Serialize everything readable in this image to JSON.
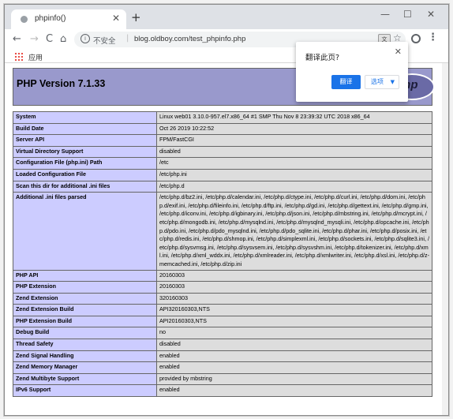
{
  "browser": {
    "tab_title": "phpinfo()",
    "tab_close": "✕",
    "new_tab": "+",
    "window_controls": {
      "minimize": "—",
      "maximize": "☐",
      "close": "✕"
    },
    "nav": {
      "back": "←",
      "forward": "→",
      "reload": "C",
      "home": "⌂"
    },
    "security_label": "不安全",
    "url": "blog.oldboy.com/test_phpinfo.php",
    "bookmarks": {
      "apps_label": "应用"
    },
    "icons": [
      "favicon",
      "back-icon",
      "forward-icon",
      "reload-icon",
      "home-icon",
      "info-icon",
      "translate-icon",
      "star-icon",
      "account-icon",
      "menu-icon",
      "apps-icon"
    ]
  },
  "translate_popup": {
    "title": "翻译此页?",
    "translate_button": "翻译",
    "options_button": "选项",
    "close": "✕"
  },
  "page": {
    "title": "PHP Version 7.1.33",
    "logo_text": "php",
    "rows": [
      {
        "key": "System",
        "value": "Linux web01 3.10.0-957.el7.x86_64 #1 SMP Thu Nov 8 23:39:32 UTC 2018 x86_64"
      },
      {
        "key": "Build Date",
        "value": "Oct 26 2019 10:22:52"
      },
      {
        "key": "Server API",
        "value": "FPM/FastCGI"
      },
      {
        "key": "Virtual Directory Support",
        "value": "disabled"
      },
      {
        "key": "Configuration File (php.ini) Path",
        "value": "/etc"
      },
      {
        "key": "Loaded Configuration File",
        "value": "/etc/php.ini"
      },
      {
        "key": "Scan this dir for additional .ini files",
        "value": "/etc/php.d"
      },
      {
        "key": "Additional .ini files parsed",
        "value": "/etc/php.d/bz2.ini, /etc/php.d/calendar.ini, /etc/php.d/ctype.ini, /etc/php.d/curl.ini, /etc/php.d/dom.ini, /etc/php.d/exif.ini, /etc/php.d/fileinfo.ini, /etc/php.d/ftp.ini, /etc/php.d/gd.ini, /etc/php.d/gettext.ini, /etc/php.d/gmp.ini, /etc/php.d/iconv.ini, /etc/php.d/igbinary.ini, /etc/php.d/json.ini, /etc/php.d/mbstring.ini, /etc/php.d/mcrypt.ini, /etc/php.d/mongodb.ini, /etc/php.d/mysqlnd.ini, /etc/php.d/mysqlnd_mysqli.ini, /etc/php.d/opcache.ini, /etc/php.d/pdo.ini, /etc/php.d/pdo_mysqlnd.ini, /etc/php.d/pdo_sqlite.ini, /etc/php.d/phar.ini, /etc/php.d/posix.ini, /etc/php.d/redis.ini, /etc/php.d/shmop.ini, /etc/php.d/simplexml.ini, /etc/php.d/sockets.ini, /etc/php.d/sqlite3.ini, /etc/php.d/sysvmsg.ini, /etc/php.d/sysvsem.ini, /etc/php.d/sysvshm.ini, /etc/php.d/tokenizer.ini, /etc/php.d/xml.ini, /etc/php.d/xml_wddx.ini, /etc/php.d/xmlreader.ini, /etc/php.d/xmlwriter.ini, /etc/php.d/xsl.ini, /etc/php.d/z-memcached.ini, /etc/php.d/zip.ini"
      },
      {
        "key": "PHP API",
        "value": "20160303"
      },
      {
        "key": "PHP Extension",
        "value": "20160303"
      },
      {
        "key": "Zend Extension",
        "value": "320160303"
      },
      {
        "key": "Zend Extension Build",
        "value": "API320160303,NTS"
      },
      {
        "key": "PHP Extension Build",
        "value": "API20160303,NTS"
      },
      {
        "key": "Debug Build",
        "value": "no"
      },
      {
        "key": "Thread Safety",
        "value": "disabled"
      },
      {
        "key": "Zend Signal Handling",
        "value": "enabled"
      },
      {
        "key": "Zend Memory Manager",
        "value": "enabled"
      },
      {
        "key": "Zend Multibyte Support",
        "value": "provided by mbstring"
      },
      {
        "key": "IPv6 Support",
        "value": "enabled"
      }
    ]
  },
  "colors": {
    "header_bg": "#9999cc",
    "key_cell_bg": "#ccccff",
    "value_cell_bg": "#dddddd",
    "accent": "#1a73e8"
  }
}
